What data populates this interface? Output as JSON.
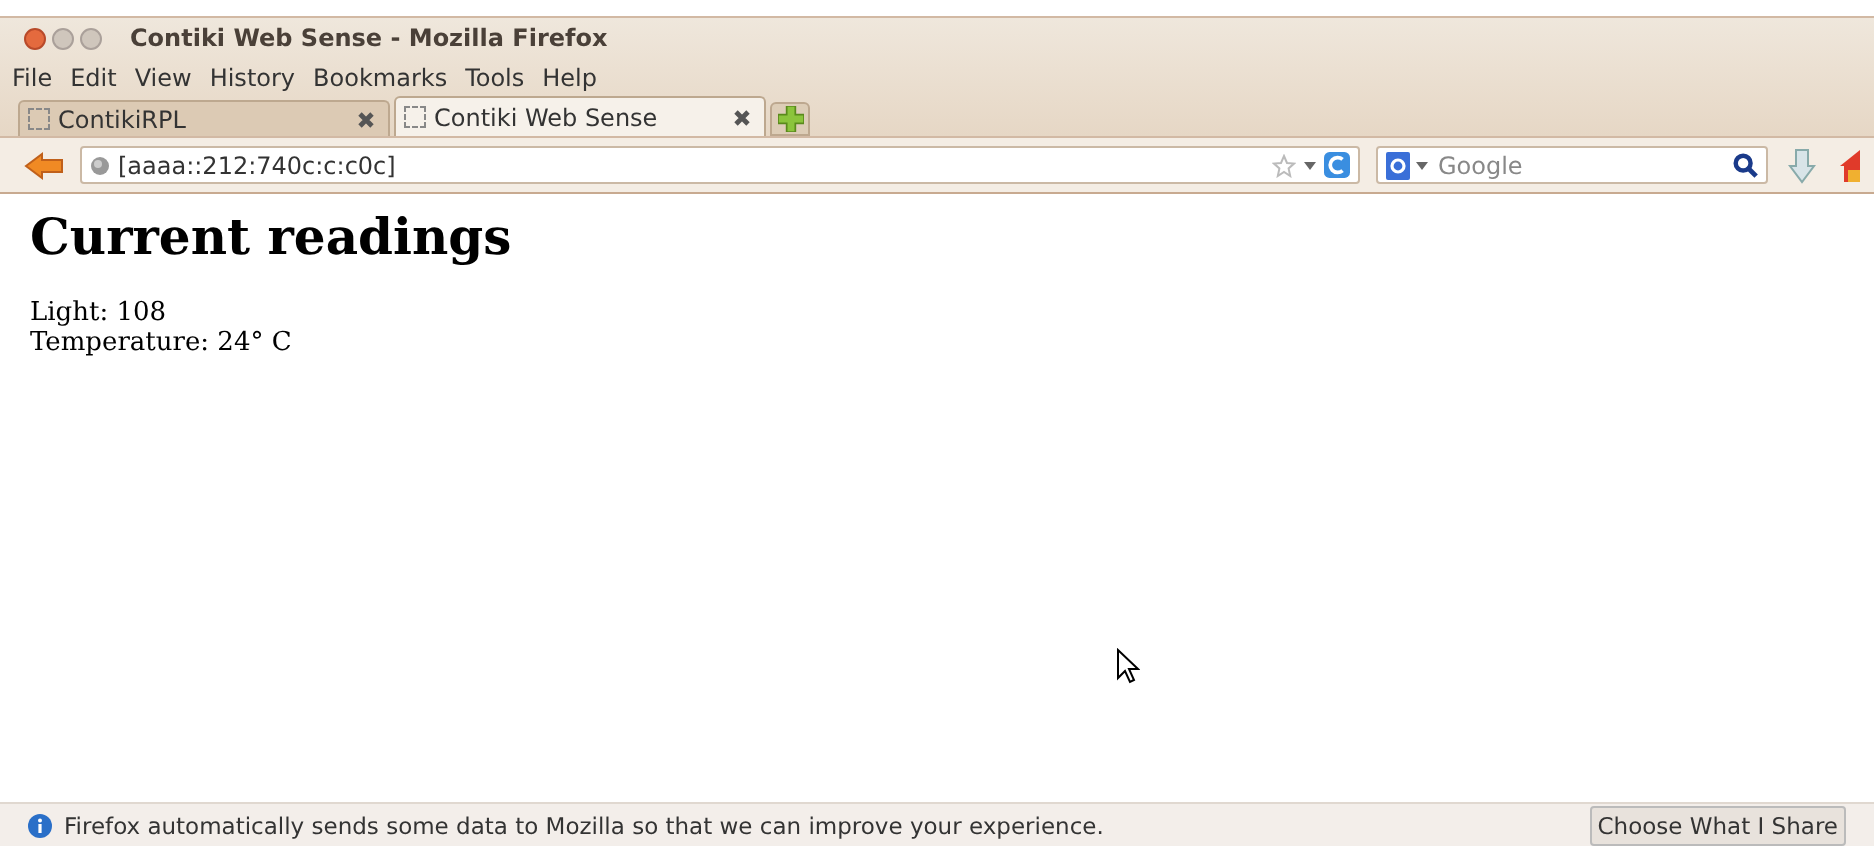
{
  "window": {
    "title": "Contiki Web Sense - Mozilla Firefox"
  },
  "menu": [
    "File",
    "Edit",
    "View",
    "History",
    "Bookmarks",
    "Tools",
    "Help"
  ],
  "tabs": [
    {
      "label": "ContikiRPL",
      "selected": false
    },
    {
      "label": "Contiki Web Sense",
      "selected": true
    }
  ],
  "address_bar": {
    "value": "[aaaa::212:740c:c:c0c]"
  },
  "search": {
    "placeholder": "Google"
  },
  "page": {
    "heading": "Current readings",
    "lines": [
      "Light: 108",
      "Temperature: 24° C"
    ]
  },
  "notification_bar": {
    "message": "Firefox automatically sends some data to Mozilla so that we can improve your experience.",
    "button": "Choose What I Share"
  }
}
